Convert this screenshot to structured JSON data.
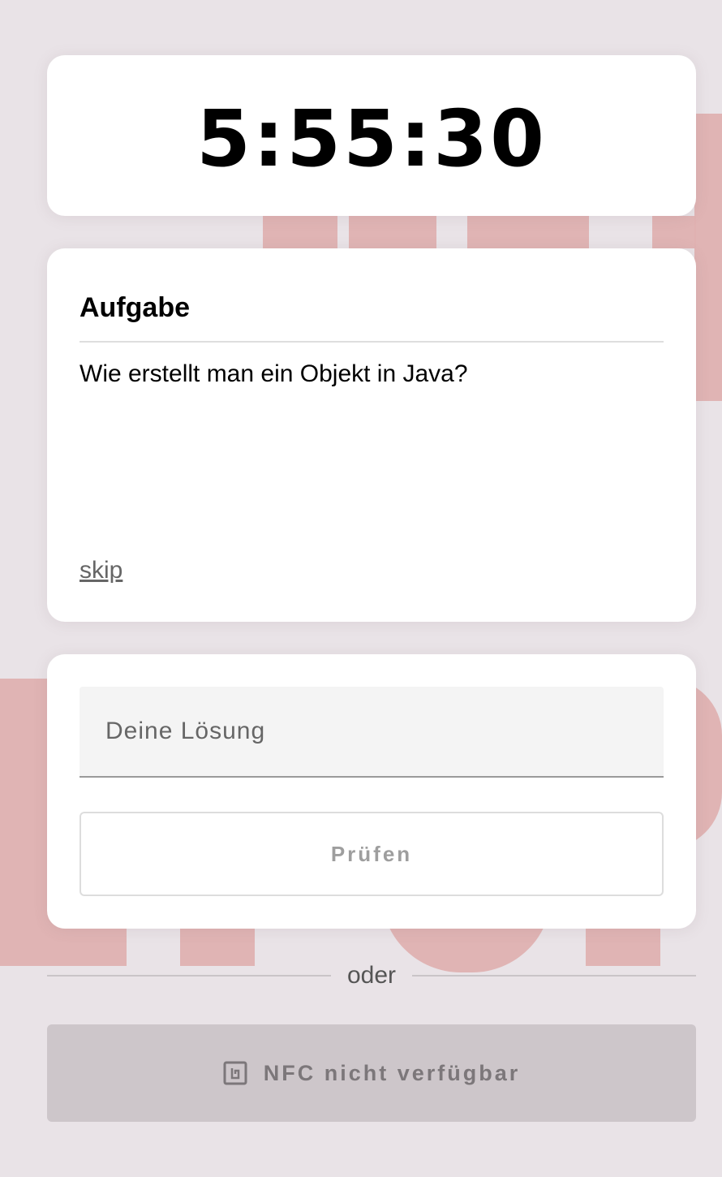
{
  "timer": {
    "value": "5:55:30"
  },
  "task": {
    "heading": "Aufgabe",
    "question": "Wie erstellt man ein Objekt in Java?",
    "skip_label": "skip"
  },
  "answer": {
    "placeholder": "Deine Lösung",
    "value": "",
    "check_label": "Prüfen"
  },
  "divider": {
    "label": "oder"
  },
  "nfc": {
    "icon": "nfc-icon",
    "label": "NFC nicht verfügbar"
  },
  "colors": {
    "background": "#e9e3e7",
    "decor": "#dfb1b1",
    "card": "#ffffff",
    "nfc_button": "#cdc6ca"
  }
}
